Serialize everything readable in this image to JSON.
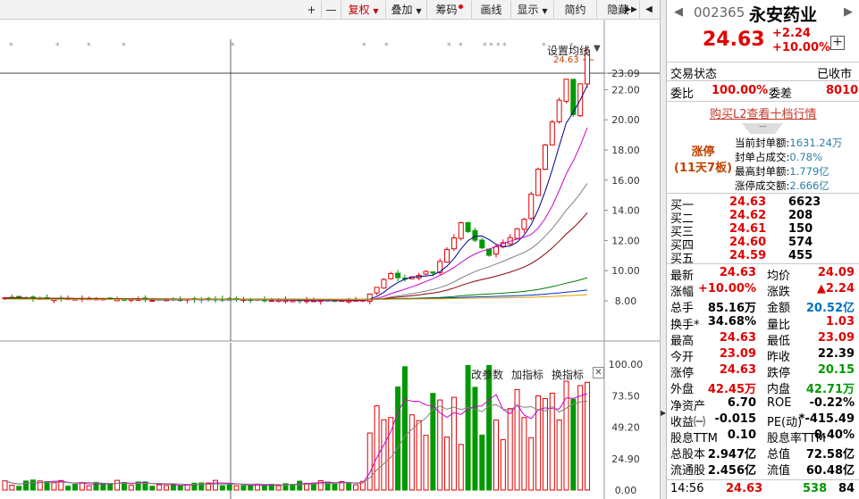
{
  "toolbar": {
    "buttons": [
      "+",
      "—",
      "复权",
      "叠加",
      "筹码",
      "画线",
      "显示",
      "简约",
      "隐藏"
    ]
  },
  "chart": {
    "ma_setting_label": "设置均线",
    "last_price_label": "24.63",
    "price_axis": [
      "23.09",
      "22.00",
      "20.00",
      "18.00",
      "16.00",
      "14.00",
      "12.00",
      "10.00",
      "8.00"
    ],
    "volume_axis": [
      "100.00",
      "73.50",
      "49.20",
      "24.90",
      "0.00"
    ],
    "indicator_buttons": [
      "改参数",
      "加指标",
      "换指标"
    ],
    "close_label": "✕",
    "ylim": [
      7.0,
      25.0
    ]
  },
  "stock": {
    "code": "002365",
    "name": "永安药业",
    "price": "24.63",
    "change": "+2.24",
    "change_pct": "+10.00%",
    "add_label": "+"
  },
  "status": {
    "trade_status_label": "交易状态",
    "trade_status_value": "已收市",
    "weibi_label": "委比",
    "weibi_value": "100.00%",
    "weicha_label": "委差",
    "weicha_value": "8010"
  },
  "l2": {
    "link": "购买L2查看十档行情",
    "tab": "—"
  },
  "limit_up": {
    "title": "涨停",
    "subtitle": "(11天7板)",
    "rows": [
      {
        "k": "当前封单额:",
        "v": "1631.24万"
      },
      {
        "k": "封单占成交:",
        "v": "0.78%"
      },
      {
        "k": "最高封单额:",
        "v": "1.779亿"
      },
      {
        "k": "涨停成交额:",
        "v": "2.666亿"
      }
    ]
  },
  "order_book": [
    {
      "label": "买一",
      "price": "24.63",
      "vol": "6623"
    },
    {
      "label": "买二",
      "price": "24.62",
      "vol": "208"
    },
    {
      "label": "买三",
      "price": "24.61",
      "vol": "150"
    },
    {
      "label": "买四",
      "price": "24.60",
      "vol": "574"
    },
    {
      "label": "买五",
      "price": "24.59",
      "vol": "455"
    }
  ],
  "quote": [
    {
      "l1": "最新",
      "v1": "24.63",
      "c1": "red",
      "l2": "均价",
      "v2": "24.09",
      "c2": "red"
    },
    {
      "l1": "涨幅",
      "v1": "+10.00%",
      "c1": "red",
      "l2": "涨跌",
      "v2": "▲2.24",
      "c2": "red"
    },
    {
      "l1": "总手",
      "v1": "85.16万",
      "c1": "black",
      "l2": "金额",
      "v2": "20.52亿",
      "c2": "blue"
    },
    {
      "l1": "换手*",
      "v1": "34.68%",
      "c1": "black",
      "l2": "量比",
      "v2": "1.03",
      "c2": "red"
    },
    {
      "l1": "最高",
      "v1": "24.63",
      "c1": "red",
      "l2": "最低",
      "v2": "23.09",
      "c2": "red"
    },
    {
      "l1": "今开",
      "v1": "23.09",
      "c1": "red",
      "l2": "昨收",
      "v2": "22.39",
      "c2": "black"
    },
    {
      "l1": "涨停",
      "v1": "24.63",
      "c1": "red",
      "l2": "跌停",
      "v2": "20.15",
      "c2": "green"
    },
    {
      "l1": "外盘",
      "v1": "42.45万",
      "c1": "red",
      "l2": "内盘",
      "v2": "42.71万",
      "c2": "green"
    },
    {
      "l1": "净资产",
      "v1": "6.70",
      "c1": "black",
      "l2": "ROE",
      "v2": "-0.22%",
      "c2": "black"
    },
    {
      "l1": "收益㈠",
      "v1": "-0.015",
      "c1": "black",
      "l2": "PE(动)",
      "v2": "*-415.49",
      "c2": "black"
    },
    {
      "l1": "股息TTM",
      "v1": "0.10",
      "c1": "black",
      "l2": "股息率TTM",
      "v2": "0.40%",
      "c2": "black"
    },
    {
      "l1": "总股本",
      "v1": "2.947亿",
      "c1": "black",
      "l2": "总值",
      "v2": "72.58亿",
      "c2": "black"
    },
    {
      "l1": "流通股",
      "v1": "2.456亿",
      "c1": "black",
      "l2": "流值",
      "v2": "60.48亿",
      "c2": "black"
    }
  ],
  "last_tick": {
    "time": "14:56",
    "price": "24.63",
    "vol": "538",
    "num": "84"
  },
  "colors": {
    "up": "#e00000",
    "down": "#009900",
    "accent": "#c00000"
  }
}
